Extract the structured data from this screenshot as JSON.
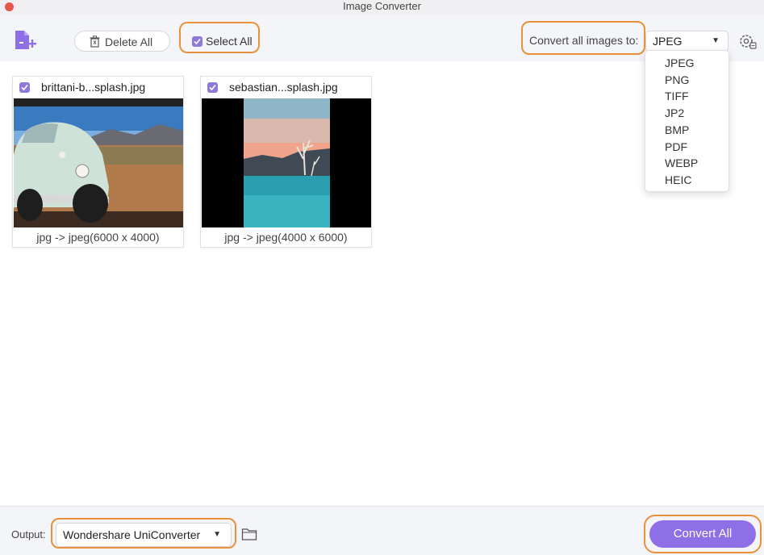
{
  "window": {
    "title": "Image Converter"
  },
  "toolbar": {
    "delete_all_label": "Delete All",
    "select_all_label": "Select All",
    "select_all_checked": true,
    "convert_label": "Convert all images to:",
    "format_value": "JPEG"
  },
  "format_dropdown": {
    "options": [
      "JPEG",
      "PNG",
      "TIFF",
      "JP2",
      "BMP",
      "PDF",
      "WEBP",
      "HEIC"
    ]
  },
  "images": [
    {
      "filename": "brittani-b...splash.jpg",
      "info": "jpg -> jpeg(6000 x 4000)",
      "checked": true
    },
    {
      "filename": "sebastian...splash.jpg",
      "info": "jpg -> jpeg(4000 x 6000)",
      "checked": true
    }
  ],
  "footer": {
    "output_label": "Output:",
    "output_value": "Wondershare UniConverter",
    "convert_all_label": "Convert All"
  },
  "colors": {
    "accent": "#8f6fe6",
    "highlight": "#e8903a",
    "checkbox": "#8f79d8"
  }
}
